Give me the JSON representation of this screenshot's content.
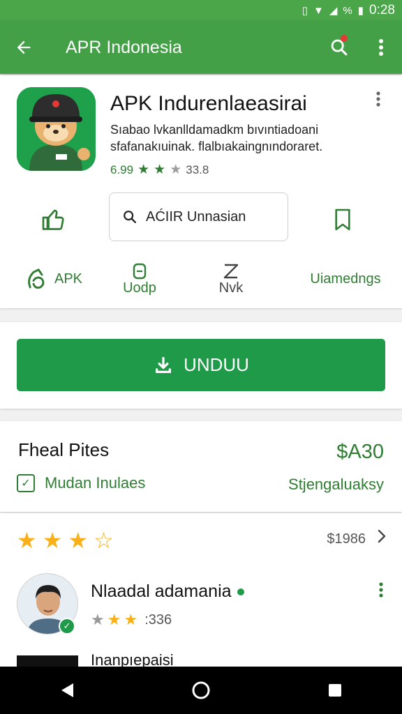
{
  "status_bar": {
    "time": "0:28",
    "battery": "%"
  },
  "app_bar": {
    "title": "APR Indonesia"
  },
  "app": {
    "name": "APK Indurenlaeasirai",
    "description": "Sıabao lvkanlldamadkm bıvıntiadoani sfafanakıuinak. flalbıakaingnındoraret.",
    "rating_value": "6.99",
    "rating_count": "33.8",
    "stars": 3
  },
  "search": {
    "value": "AĆIIR Unnasian"
  },
  "tabs": [
    {
      "label": "APK"
    },
    {
      "label": "Uodp"
    },
    {
      "label": "Nvk"
    },
    {
      "label": "Uiamedngs"
    }
  ],
  "install": {
    "label": "UNDUU"
  },
  "price": {
    "title": "Fheal Pites",
    "value": "$A30",
    "feature_label": "Mudan Inulaes",
    "feature_right": "Stjengaluaksy"
  },
  "reviews": {
    "summary_stars": 3.5,
    "summary_count": "$1986",
    "reviewer": {
      "name": "Nlaadal adamania",
      "rating_count": ":336"
    },
    "next_title": "Inanpıepaisi"
  },
  "colors": {
    "primary": "#43a047",
    "install": "#1e9a49",
    "accent_text": "#2e7d32",
    "star": "#f9b11b"
  }
}
